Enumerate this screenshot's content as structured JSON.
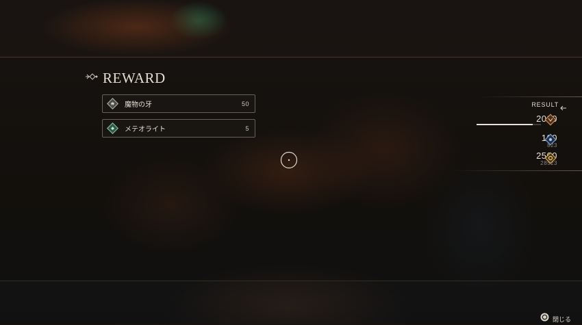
{
  "reward": {
    "title": "REWARD",
    "items": [
      {
        "name": "魔物の牙",
        "quantity": "50",
        "icon": "fang-icon"
      },
      {
        "name": "メテオライト",
        "quantity": "5",
        "icon": "meteorite-icon"
      }
    ]
  },
  "result": {
    "label": "RESULT",
    "stats": [
      {
        "value": "2000",
        "sub": "",
        "icon": "exp-icon",
        "progress": 0.87
      },
      {
        "value": "100",
        "sub": "823",
        "icon": "ap-icon"
      },
      {
        "value": "2500",
        "sub": "28523",
        "icon": "gil-icon"
      }
    ]
  },
  "controls": {
    "close_label": "閉じる",
    "close_button_icon": "circle-button-icon"
  },
  "colors": {
    "accent_gold": "#b8894f",
    "accent_blue": "#6f95c8",
    "panel_border": "#bea078"
  }
}
